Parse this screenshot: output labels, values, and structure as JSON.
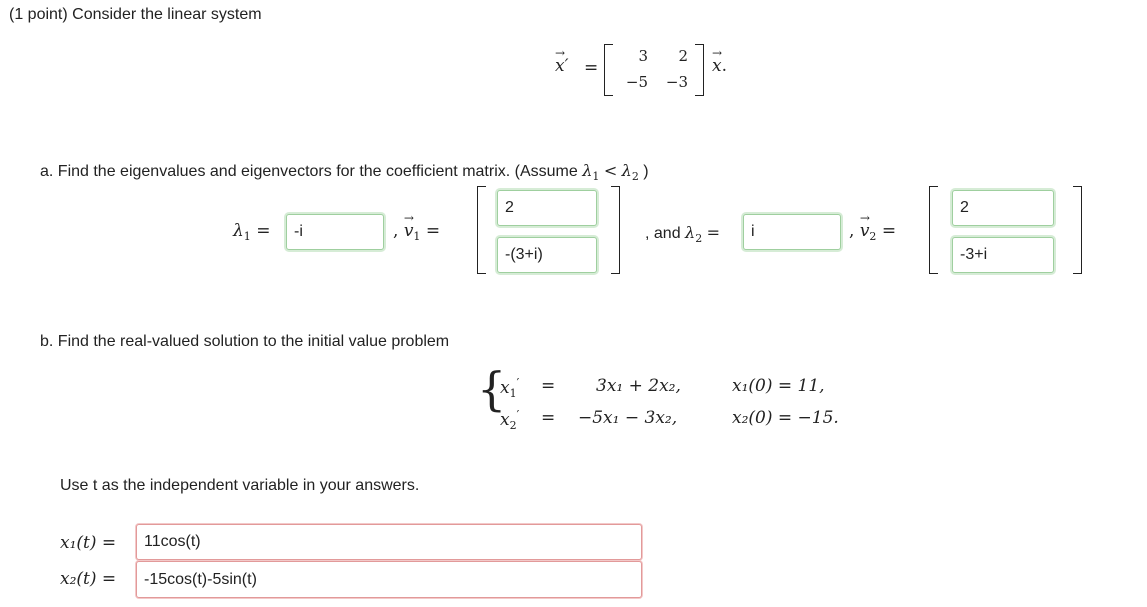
{
  "intro": "(1 point) Consider the linear system",
  "matrix": {
    "a11": "3",
    "a12": "2",
    "a21": "−5",
    "a22": "−3"
  },
  "eq_prime": "′",
  "eq_equals": "=",
  "eq_period": ".",
  "part_a": {
    "text": "a. Find the eigenvalues and eigenvectors for the coefficient matrix. (Assume",
    "close_paren": ")",
    "lambda1_value": "-i",
    "v1_top": "2",
    "v1_bottom": "-(3+i)",
    "and_text": ", and",
    "lambda2_value": "i",
    "v2_top": "2",
    "v2_bottom": "-3+i",
    "comma": ","
  },
  "part_b": {
    "text": "b. Find the real-valued solution to the initial value problem",
    "row1_rhs": "3x₁ + 2x₂,",
    "row1_ic": "x₁(0) = 11,",
    "row2_rhs": "−5x₁ − 3x₂,",
    "row2_ic": "x₂(0) = −15."
  },
  "instructions": "Use t as the independent variable in your answers.",
  "answers": {
    "x1_label": "x₁(t)",
    "x2_label": "x₂(t)",
    "equals": "=",
    "x1_value": "11cos(t)",
    "x2_value": "-15cos(t)-5sin(t)"
  },
  "status_colors": {
    "correct": "#9fcf9f",
    "incorrect": "#e29a9a"
  }
}
